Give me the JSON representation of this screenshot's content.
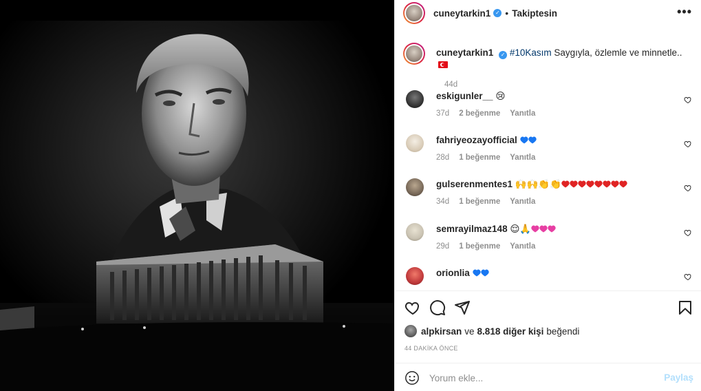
{
  "post": {
    "author": "cuneytarkin1",
    "follow_state": "Takiptesin",
    "more_icon": "more-horizontal-icon",
    "caption_hashtag": "#10Kasım",
    "caption_text": "Saygıyla, özlemle ve minnetle..",
    "caption_emoji": "turkey-flag-emoji",
    "caption_time": "44d"
  },
  "comments": [
    {
      "user": "eskigunler__",
      "text": "😢",
      "time": "37d",
      "likes": "2 beğenme",
      "reply": "Yanıtla",
      "avatar_color": "#2b2b2b"
    },
    {
      "user": "fahriyeozayofficial",
      "text": "",
      "hearts": "blue2",
      "time": "28d",
      "likes": "1 beğenme",
      "reply": "Yanıtla",
      "avatar_color": "#e6dccd"
    },
    {
      "user": "gulserenmentes1",
      "text": "🙌🙌👏👏",
      "hearts": "red8",
      "time": "34d",
      "likes": "1 beğenme",
      "reply": "Yanıtla",
      "avatar_color": "#7a6a5a"
    },
    {
      "user": "semrayilmaz148",
      "text": "😌🙏",
      "hearts": "pink3",
      "time": "29d",
      "likes": "1 beğenme",
      "reply": "Yanıtla",
      "avatar_color": "#c9c2b2"
    },
    {
      "user": "orionlia",
      "text": "",
      "hearts": "blue2",
      "time": "",
      "likes": "",
      "reply": "",
      "avatar_color": "#c0393b"
    }
  ],
  "likes_line": {
    "user": "alpkirsan",
    "connector": "ve",
    "others": "8.818 diğer kişi",
    "suffix": "beğendi"
  },
  "timestamp": "44 DAKİKA ÖNCE",
  "add_comment": {
    "placeholder": "Yorum ekle...",
    "post_label": "Paylaş"
  },
  "colors": {
    "accent": "#3897f0",
    "link_dark": "#00376b",
    "muted": "#8e8e8e",
    "post_disabled": "#b2dffc"
  }
}
